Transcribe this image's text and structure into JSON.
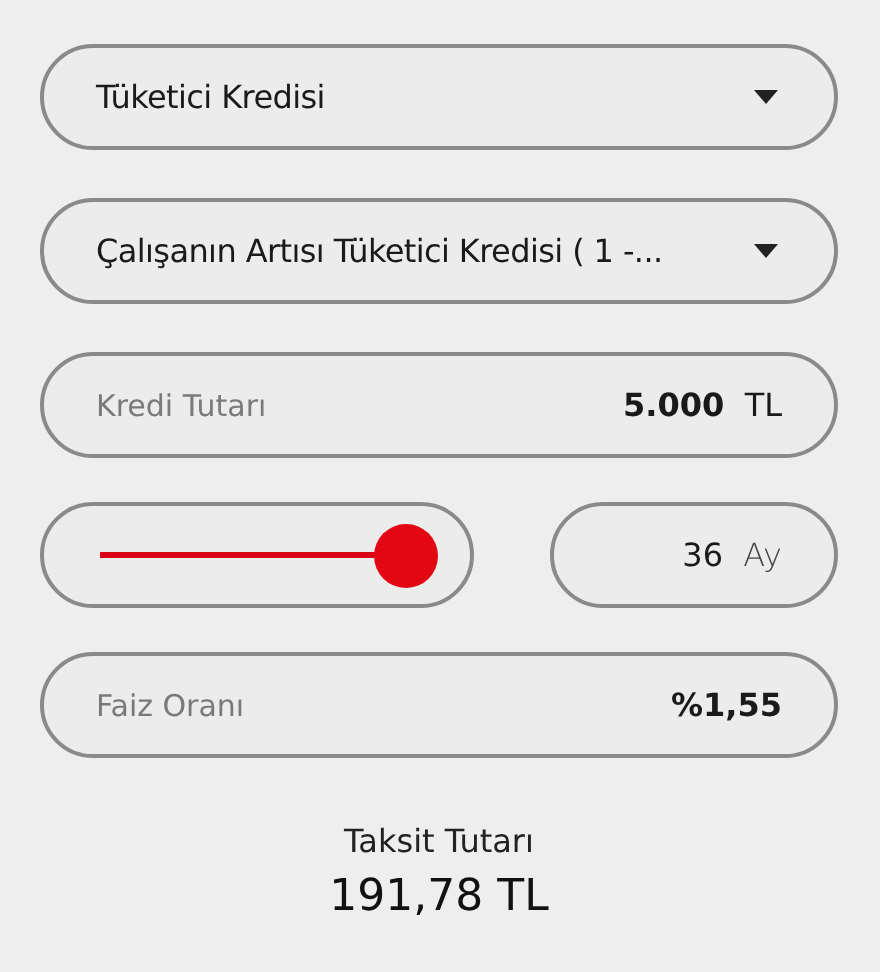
{
  "dropdowns": [
    {
      "value": "Tüketici Kredisi"
    },
    {
      "value": "Çalışanın Artısı Tüketici Kredisi ( 1 -..."
    }
  ],
  "amount": {
    "label": "Kredi Tutarı",
    "value": "5.000",
    "unit": "TL"
  },
  "term": {
    "level": 1,
    "value": "36",
    "unit": "Ay"
  },
  "rate": {
    "label": "Faiz Oranı",
    "symbol": "%",
    "value": "1,55"
  },
  "result": {
    "label": "Taksit Tutarı",
    "value": "191,78 TL"
  }
}
